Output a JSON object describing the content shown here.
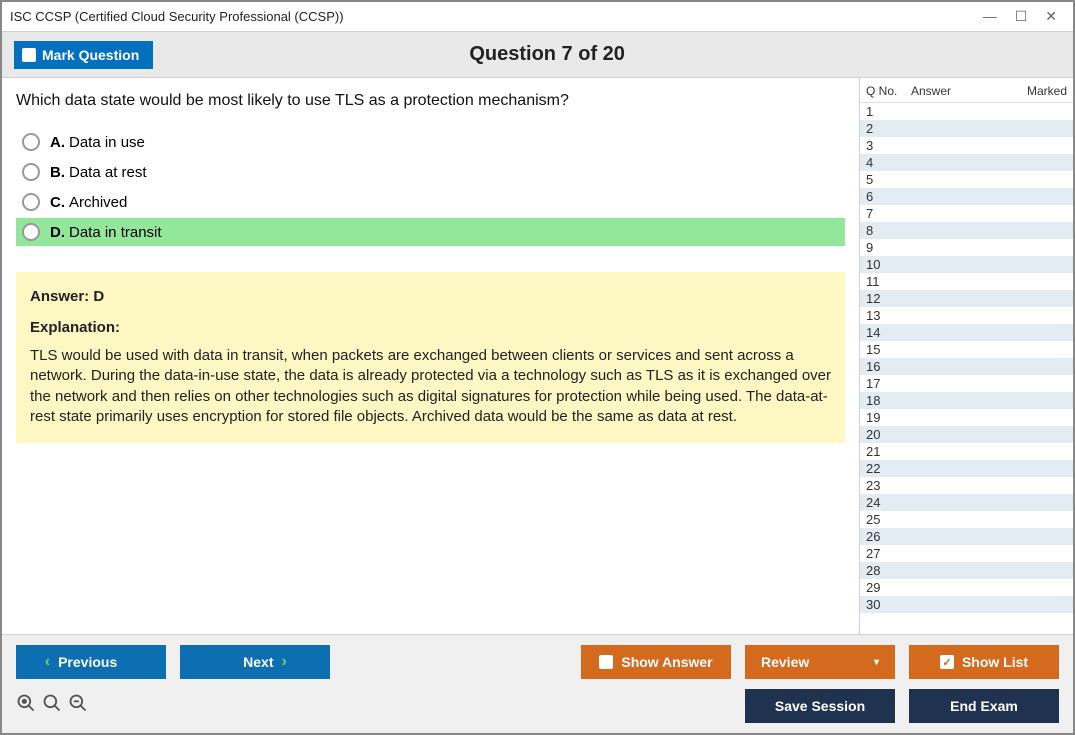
{
  "window": {
    "title": "ISC CCSP (Certified Cloud Security Professional (CCSP))"
  },
  "header": {
    "mark_label": "Mark Question",
    "question_header": "Question 7 of 20"
  },
  "question": {
    "text": "Which data state would be most likely to use TLS as a protection mechanism?",
    "options": [
      {
        "letter": "A.",
        "text": "Data in use",
        "selected": false
      },
      {
        "letter": "B.",
        "text": "Data at rest",
        "selected": false
      },
      {
        "letter": "C.",
        "text": "Archived",
        "selected": false
      },
      {
        "letter": "D.",
        "text": "Data in transit",
        "selected": true
      }
    ]
  },
  "answer": {
    "line": "Answer: D",
    "label": "Explanation:",
    "text": "TLS would be used with data in transit, when packets are exchanged between clients or services and sent across a network. During the data-in-use state, the data is already protected via a technology such as TLS as it is exchanged over the network and then relies on other technologies such as digital signatures for protection while being used. The data-at-rest state primarily uses encryption for stored file objects. Archived data would be the same as data at rest."
  },
  "sidebar": {
    "headers": {
      "qno": "Q No.",
      "answer": "Answer",
      "marked": "Marked"
    },
    "rows": [
      "1",
      "2",
      "3",
      "4",
      "5",
      "6",
      "7",
      "8",
      "9",
      "10",
      "11",
      "12",
      "13",
      "14",
      "15",
      "16",
      "17",
      "18",
      "19",
      "20",
      "21",
      "22",
      "23",
      "24",
      "25",
      "26",
      "27",
      "28",
      "29",
      "30"
    ]
  },
  "footer": {
    "previous": "Previous",
    "next": "Next",
    "show_answer": "Show Answer",
    "review": "Review",
    "show_list": "Show List",
    "save_session": "Save Session",
    "end_exam": "End Exam"
  }
}
